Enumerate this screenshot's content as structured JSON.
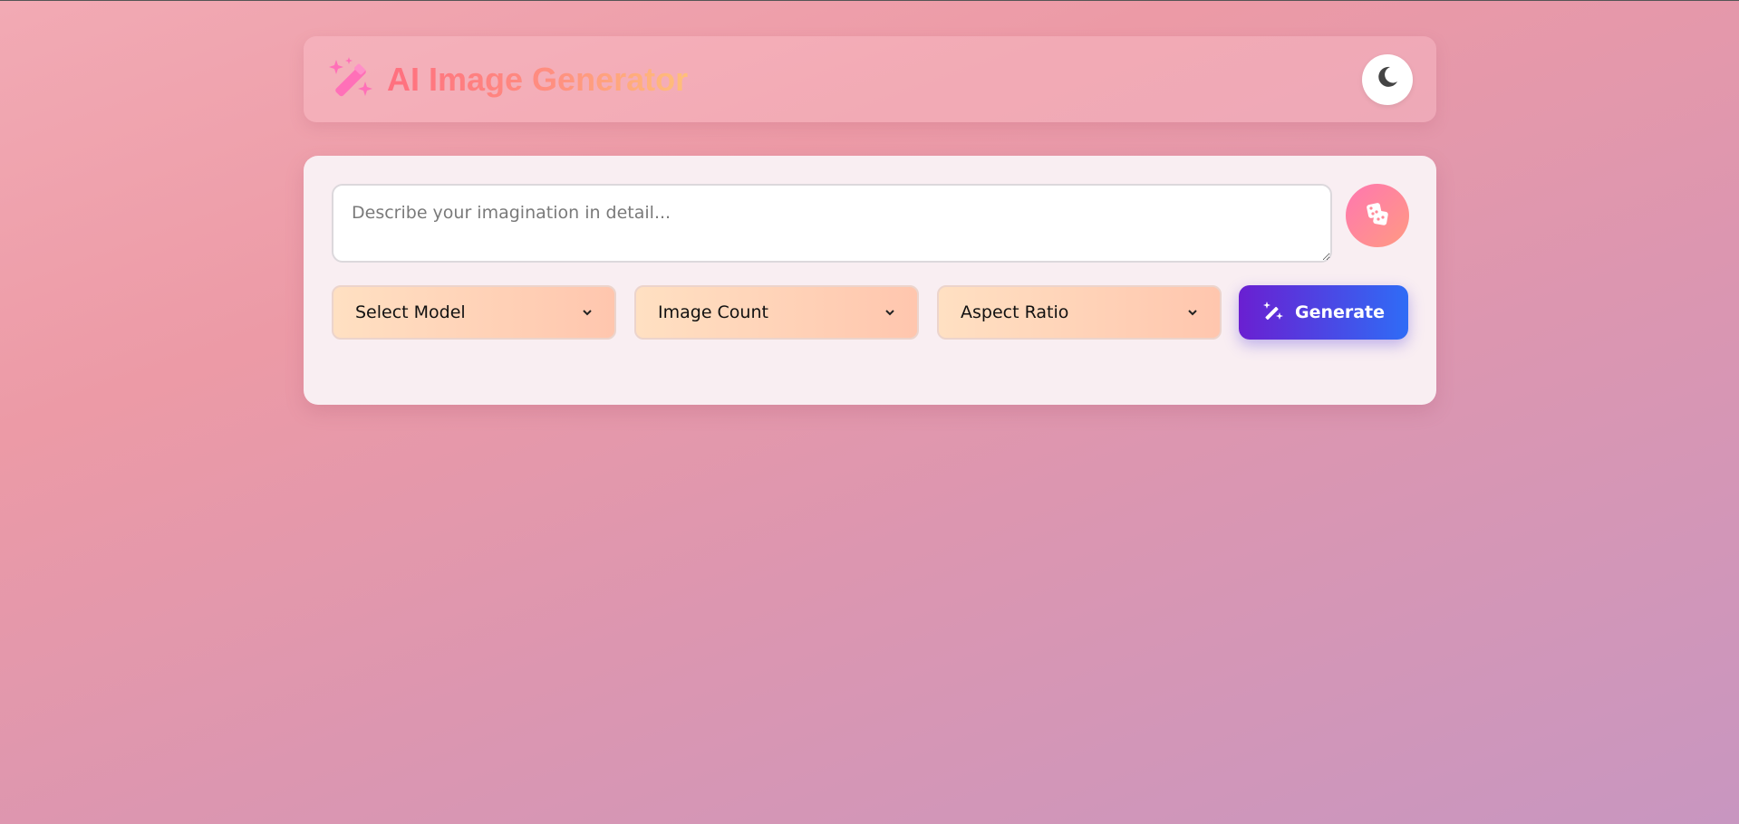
{
  "header": {
    "title": "AI Image Generator",
    "logo_icon": "magic-wand-sparkles-icon",
    "theme_toggle_icon": "moon-icon"
  },
  "prompt": {
    "placeholder": "Describe your imagination in detail...",
    "value": ""
  },
  "random_prompt_button": {
    "icon": "dice-icon"
  },
  "controls": {
    "model_select": {
      "label": "Select Model"
    },
    "count_select": {
      "label": "Image Count"
    },
    "ratio_select": {
      "label": "Aspect Ratio"
    }
  },
  "generate_button": {
    "label": "Generate",
    "icon": "magic-wand-icon"
  },
  "colors": {
    "accent_start": "#6a1fd1",
    "accent_end": "#2f6cf6",
    "title_gradient": [
      "#ff6f7f",
      "#ffc07a"
    ],
    "logo": "#ff6fb5"
  }
}
